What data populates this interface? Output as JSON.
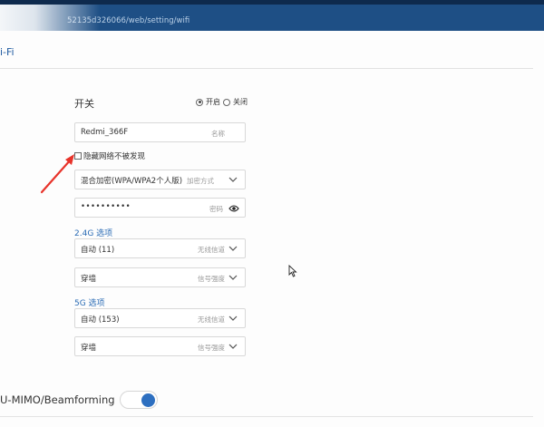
{
  "browser": {
    "url": "52135d326066/web/setting/wifi"
  },
  "section": {
    "title": "i-Fi"
  },
  "wifi": {
    "switch_label": "开关",
    "on_label": "开启",
    "off_label": "关闭",
    "enabled": true,
    "ssid": {
      "value": "Redmi_366F",
      "hint": "名称"
    },
    "hidden_network_label": "隐藏网络不被发现",
    "hidden_network_checked": false,
    "encryption": {
      "value": "混合加密(WPA/WPA2个人版)",
      "hint": "加密方式"
    },
    "password": {
      "value": "••••••••••",
      "hint": "密码"
    }
  },
  "band_24": {
    "title": "2.4G 选项",
    "channel": {
      "value": "自动 (11)",
      "hint": "无线信道"
    },
    "signal": {
      "value": "穿墙",
      "hint": "信号强度"
    }
  },
  "band_5": {
    "title": "5G 选项",
    "channel": {
      "value": "自动 (153)",
      "hint": "无线信道"
    },
    "signal": {
      "value": "穿墙",
      "hint": "信号强度"
    }
  },
  "mimo": {
    "label": "U-MIMO/Beamforming",
    "enabled": true
  },
  "colors": {
    "accent": "#2d6fc0",
    "header": "#1e4f85",
    "arrow": "#e8332a"
  },
  "icons": {
    "dropdown": "chevron-down-icon",
    "password": "eye-icon"
  }
}
